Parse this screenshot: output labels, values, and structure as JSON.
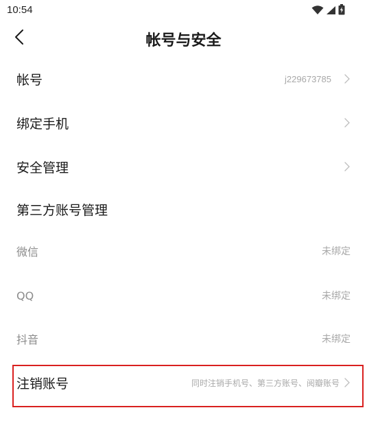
{
  "status_bar": {
    "time": "10:54",
    "icons": [
      "wifi-icon",
      "signal-icon",
      "battery-charging-icon"
    ]
  },
  "header": {
    "title": "帐号与安全",
    "back_icon": "chevron-left-icon"
  },
  "rows": {
    "account": {
      "label": "帐号",
      "value": "j229673785"
    },
    "bind_phone": {
      "label": "绑定手机"
    },
    "security": {
      "label": "安全管理"
    },
    "third_party": {
      "label": "第三方账号管理"
    },
    "wechat": {
      "label": "微信",
      "value": "未绑定"
    },
    "qq": {
      "label": "QQ",
      "value": "未绑定"
    },
    "douyin": {
      "label": "抖音",
      "value": "未绑定"
    },
    "deregister": {
      "label": "注销账号",
      "value": "同时注销手机号、第三方账号、阅瓣账号"
    }
  },
  "colors": {
    "highlight": "#d9201f",
    "muted_text": "#a8a8a8",
    "primary_text": "#1a1a1a"
  }
}
